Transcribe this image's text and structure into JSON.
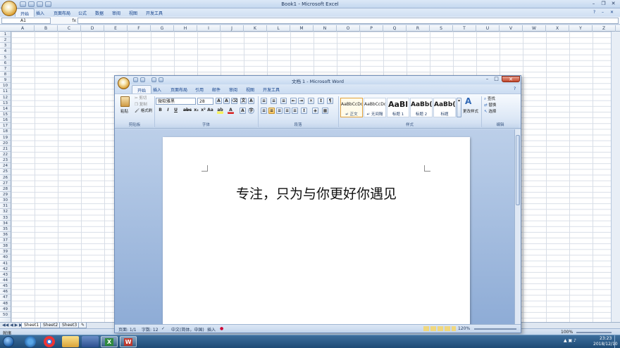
{
  "excel": {
    "title": "Book1 - Microsoft Excel",
    "tabs": [
      "开始",
      "插入",
      "页面布局",
      "公式",
      "数据",
      "审阅",
      "视图",
      "开发工具"
    ],
    "name_box": "A1",
    "fx": "fx",
    "columns": [
      "A",
      "B",
      "C",
      "D",
      "E",
      "F",
      "G",
      "H",
      "I",
      "J",
      "K",
      "L",
      "M",
      "N",
      "O",
      "P",
      "Q",
      "R",
      "S",
      "T",
      "U",
      "V",
      "W",
      "X",
      "Y",
      "Z"
    ],
    "rows": [
      "1",
      "2",
      "3",
      "4",
      "5",
      "6",
      "7",
      "8",
      "9",
      "10",
      "11",
      "12",
      "13",
      "14",
      "15",
      "16",
      "17",
      "18",
      "19",
      "20",
      "21",
      "22",
      "23",
      "24",
      "25",
      "26",
      "27",
      "28",
      "29",
      "30",
      "31",
      "32",
      "33",
      "34",
      "35",
      "36",
      "37",
      "38",
      "39",
      "40",
      "41",
      "42",
      "43",
      "44",
      "45",
      "46",
      "47",
      "48",
      "49",
      "50"
    ],
    "sheets": [
      "Sheet1",
      "Sheet2",
      "Sheet3"
    ],
    "status_ready": "就绪",
    "zoom": "100%"
  },
  "word": {
    "title": "文档 1 - Microsoft Word",
    "tabs": [
      "开始",
      "插入",
      "页面布局",
      "引用",
      "邮件",
      "审阅",
      "视图",
      "开发工具"
    ],
    "clipboard": {
      "paste": "粘贴",
      "cut": "剪切",
      "copy": "复制",
      "format_painter": "格式刷",
      "label": "剪贴板"
    },
    "font": {
      "name": "微软雅黑",
      "size": "28",
      "label": "字体"
    },
    "paragraph_label": "段落",
    "styles": {
      "items": [
        {
          "preview": "AaBbCcDd",
          "name": "↵ 正文"
        },
        {
          "preview": "AaBbCcDd",
          "name": "↵ 无间隔"
        },
        {
          "preview": "AaBl",
          "name": "标题 1"
        },
        {
          "preview": "AaBb(",
          "name": "标题 2"
        },
        {
          "preview": "AaBb(",
          "name": "标题"
        }
      ],
      "change": "更改样式",
      "label": "样式"
    },
    "editing": {
      "find": "查找",
      "replace": "替换",
      "select": "选择",
      "label": "编辑"
    },
    "body_text": "专注，只为与你更好你遇见",
    "status": {
      "page": "页面: 1/1",
      "words": "字数: 12",
      "language": "中文(简体，中国)",
      "mode": "插入",
      "zoom": "120%"
    }
  },
  "taskbar": {
    "time": "23:23",
    "date": "2018/12/10"
  }
}
